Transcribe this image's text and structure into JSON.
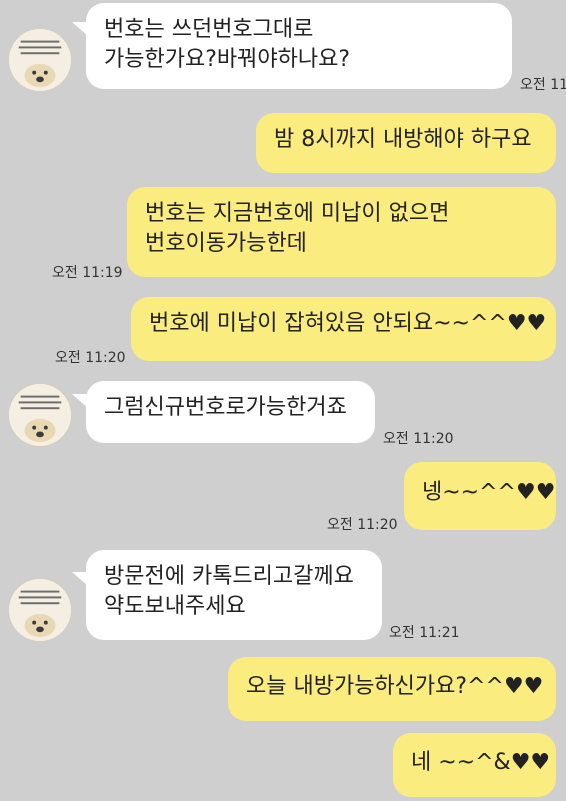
{
  "messages": [
    {
      "side": "in",
      "lines": [
        "번호는 쓰던번호그대로",
        "가능한가요?바꿔야하나요?"
      ],
      "time": "오전 11"
    },
    {
      "side": "out",
      "lines": [
        "밤 8시까지 내방해야 하구요"
      ],
      "time": ""
    },
    {
      "side": "out",
      "lines": [
        "번호는 지금번호에 미납이 없으면",
        "번호이동가능한데"
      ],
      "time": "오전 11:19"
    },
    {
      "side": "out",
      "lines": [
        "번호에 미납이 잡혀있음 안되요~~^^♥♥"
      ],
      "time": "오전 11:20"
    },
    {
      "side": "in",
      "lines": [
        "그럼신규번호로가능한거죠"
      ],
      "time": "오전 11:20"
    },
    {
      "side": "out",
      "lines": [
        "넹~~^^♥♥"
      ],
      "time": "오전 11:20"
    },
    {
      "side": "in",
      "lines": [
        "방문전에 카톡드리고갈께요",
        "약도보내주세요"
      ],
      "time": "오전 11:21"
    },
    {
      "side": "out",
      "lines": [
        "오늘 내방가능하신가요?^^♥♥"
      ],
      "time": ""
    },
    {
      "side": "out",
      "lines": [
        "네 ~~^&♥♥"
      ],
      "time": ""
    }
  ],
  "avatar": {
    "icon": "dog-profile-icon"
  },
  "colors": {
    "background": "#cfcfcf",
    "incoming_bubble": "#ffffff",
    "outgoing_bubble": "#fbec80"
  }
}
